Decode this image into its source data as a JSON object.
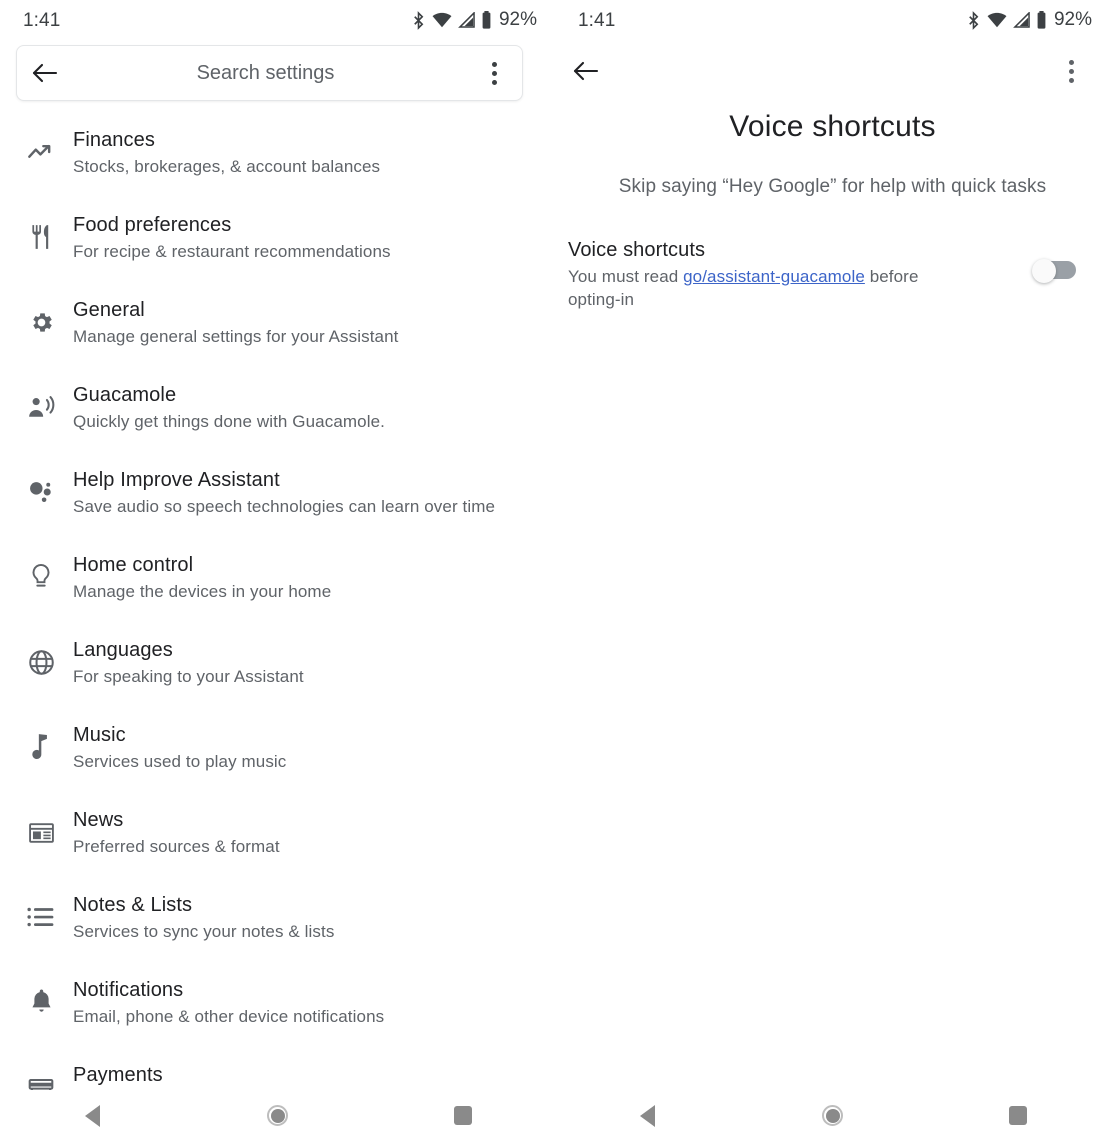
{
  "status_bar": {
    "time": "1:41",
    "battery_percent": "92%",
    "icons": [
      "bluetooth-icon",
      "wifi-icon",
      "cellular-signal-icon",
      "battery-icon"
    ]
  },
  "left_panel": {
    "search_bar": {
      "back_label": "back-arrow",
      "placeholder": "Search settings",
      "value": "",
      "overflow_label": "more-options"
    },
    "items": [
      {
        "icon": "trending-up-icon",
        "title": "Finances",
        "subtitle": "Stocks, brokerages, & account balances"
      },
      {
        "icon": "restaurant-icon",
        "title": "Food preferences",
        "subtitle": "For recipe & restaurant recommendations"
      },
      {
        "icon": "gear-icon",
        "title": "General",
        "subtitle": "Manage general settings for your Assistant"
      },
      {
        "icon": "voice-person-icon",
        "title": "Guacamole",
        "subtitle": "Quickly get things done with Guacamole."
      },
      {
        "icon": "bubbles-icon",
        "title": "Help Improve Assistant",
        "subtitle": "Save audio so speech technologies can learn over time"
      },
      {
        "icon": "lightbulb-icon",
        "title": "Home control",
        "subtitle": "Manage the devices in your home"
      },
      {
        "icon": "globe-icon",
        "title": "Languages",
        "subtitle": "For speaking to your Assistant"
      },
      {
        "icon": "music-note-icon",
        "title": "Music",
        "subtitle": "Services used to play music"
      },
      {
        "icon": "newspaper-icon",
        "title": "News",
        "subtitle": "Preferred sources & format"
      },
      {
        "icon": "list-icon",
        "title": "Notes & Lists",
        "subtitle": "Services to sync your notes & lists"
      },
      {
        "icon": "bell-icon",
        "title": "Notifications",
        "subtitle": "Email, phone & other device notifications"
      },
      {
        "icon": "payment-card-icon",
        "title": "Payments",
        "subtitle": ""
      }
    ]
  },
  "right_panel": {
    "back_label": "back-arrow",
    "overflow_label": "more-options",
    "title": "Voice shortcuts",
    "subtitle": "Skip saying “Hey Google” for help with quick tasks",
    "setting": {
      "title": "Voice shortcuts",
      "description_before": "You must read ",
      "link_text": "go/assistant-guacamole",
      "description_after": " before opting-in",
      "toggle_state": "off"
    }
  },
  "nav_bar": {
    "back_label": "back",
    "home_label": "home",
    "recents_label": "recents"
  },
  "colors": {
    "text_primary": "#202124",
    "text_secondary": "#5f6368",
    "link": "#3c64c8",
    "toggle_track_off": "#9aa0a6",
    "toggle_thumb_off": "#fafafa",
    "background": "#ffffff",
    "nav_icon": "#8a8a8a"
  }
}
